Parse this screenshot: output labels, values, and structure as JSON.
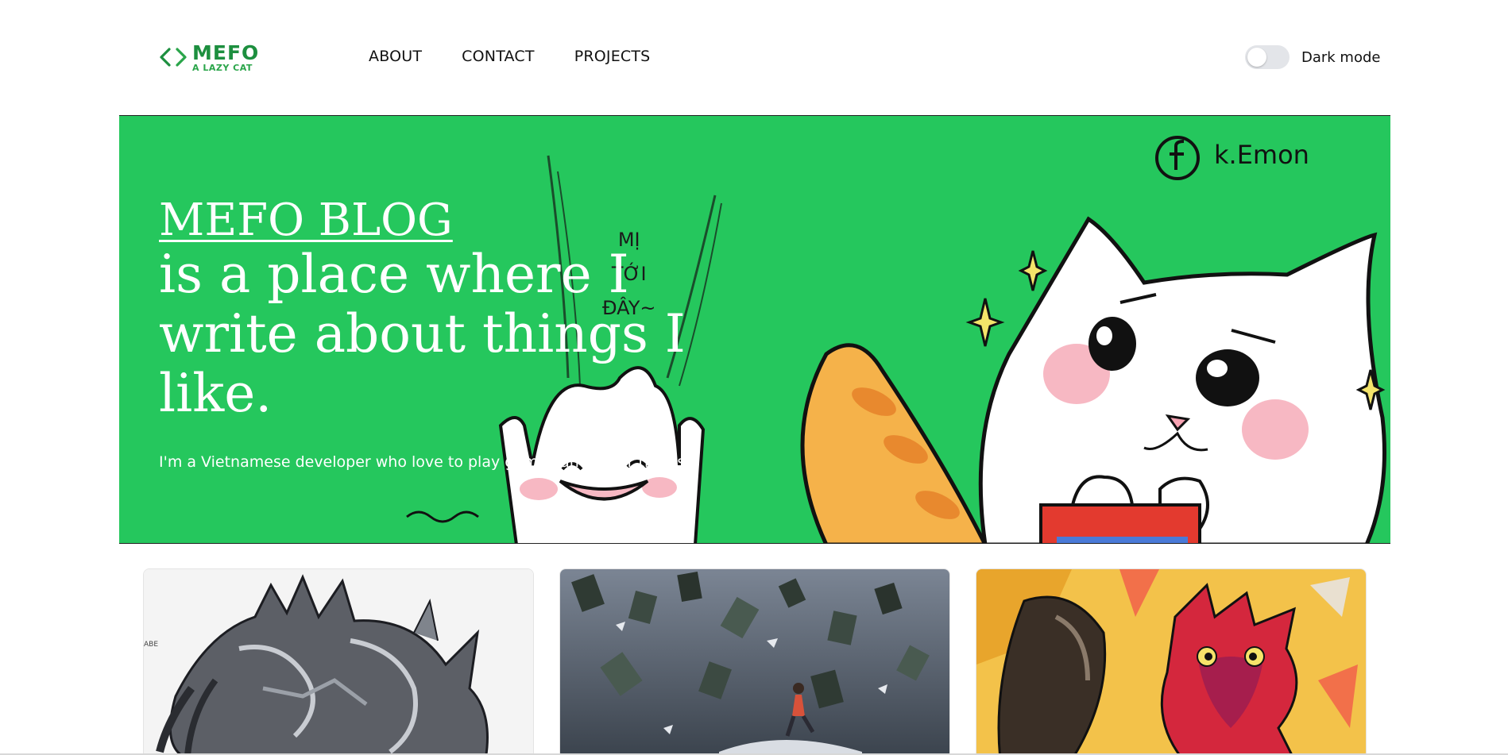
{
  "brand": {
    "title": "MEFO",
    "subtitle": "A LAZY CAT",
    "colors": {
      "primary": "#1d8f3f",
      "accent": "#2aa54a"
    },
    "icon": "code-brackets-icon"
  },
  "nav": {
    "items": [
      {
        "label": "ABOUT"
      },
      {
        "label": "CONTACT"
      },
      {
        "label": "PROJECTS"
      }
    ]
  },
  "theme_toggle": {
    "label": "Dark mode",
    "enabled": false
  },
  "hero": {
    "background": "#25c75d",
    "title": "MEFO BLOG",
    "headline": "is a place where I write about things I like.",
    "description": "I'm a Vietnamese developer who love to play games and other things.",
    "artwork": {
      "signature": "k.Emon",
      "caption_lines": [
        "MỊ",
        "TỚI",
        "ĐÂY~"
      ]
    }
  },
  "cards": [
    {
      "image": "armored-monster-illustration",
      "image_text": "ABE"
    },
    {
      "image": "flying-books-illustration"
    },
    {
      "image": "red-creature-illustration"
    }
  ]
}
